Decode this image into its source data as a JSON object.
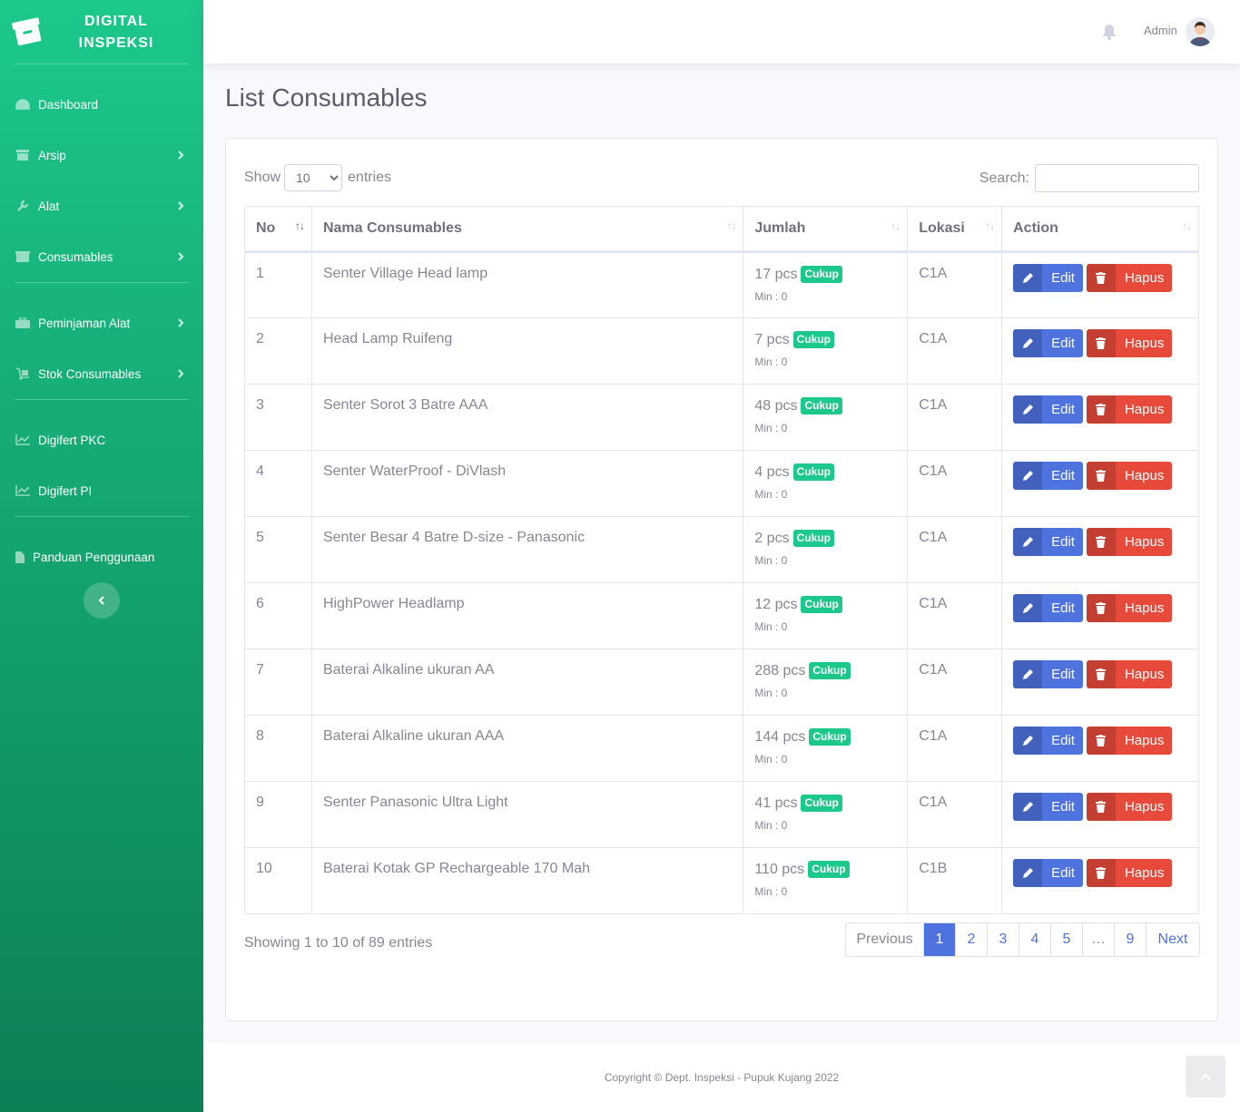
{
  "brand": {
    "line1": "DIGITAL",
    "line2": "INSPEKSI"
  },
  "sidebar": {
    "items": [
      {
        "label": "Dashboard",
        "icon": "tachometer-icon"
      },
      {
        "label": "Arsip",
        "icon": "archive-icon"
      },
      {
        "label": "Alat",
        "icon": "wrench-icon"
      },
      {
        "label": "Consumables",
        "icon": "box-icon"
      },
      {
        "label": "Peminjaman Alat",
        "icon": "toolbox-icon"
      },
      {
        "label": "Stok Consumables",
        "icon": "dolly-icon"
      },
      {
        "label": "Digifert PKC",
        "icon": "chart-line-icon"
      },
      {
        "label": "Digifert PI",
        "icon": "chart-line-icon"
      },
      {
        "label": "Panduan Penggunaan",
        "icon": "file-icon"
      }
    ]
  },
  "topbar": {
    "user_name": "Admin"
  },
  "page": {
    "title": "List Consumables"
  },
  "table_controls": {
    "show_label": "Show",
    "entries_label": "entries",
    "page_length": "10",
    "search_label": "Search:",
    "search_value": ""
  },
  "table": {
    "headers": [
      "No",
      "Nama Consumables",
      "Jumlah",
      "Lokasi",
      "Action"
    ],
    "rows": [
      {
        "no": "1",
        "name": "Senter Village Head lamp",
        "qty": "17 pcs",
        "status": "Cukup",
        "min": "Min : 0",
        "loc": "C1A"
      },
      {
        "no": "2",
        "name": "Head Lamp Ruifeng",
        "qty": "7 pcs",
        "status": "Cukup",
        "min": "Min : 0",
        "loc": "C1A"
      },
      {
        "no": "3",
        "name": "Senter Sorot 3 Batre AAA",
        "qty": "48 pcs",
        "status": "Cukup",
        "min": "Min : 0",
        "loc": "C1A"
      },
      {
        "no": "4",
        "name": "Senter WaterProof - DiVlash",
        "qty": "4 pcs",
        "status": "Cukup",
        "min": "Min : 0",
        "loc": "C1A"
      },
      {
        "no": "5",
        "name": "Senter Besar 4 Batre D-size - Panasonic",
        "qty": "2 pcs",
        "status": "Cukup",
        "min": "Min : 0",
        "loc": "C1A"
      },
      {
        "no": "6",
        "name": "HighPower Headlamp",
        "qty": "12 pcs",
        "status": "Cukup",
        "min": "Min : 0",
        "loc": "C1A"
      },
      {
        "no": "7",
        "name": "Baterai Alkaline ukuran AA",
        "qty": "288 pcs",
        "status": "Cukup",
        "min": "Min : 0",
        "loc": "C1A"
      },
      {
        "no": "8",
        "name": "Baterai Alkaline ukuran AAA",
        "qty": "144 pcs",
        "status": "Cukup",
        "min": "Min : 0",
        "loc": "C1A"
      },
      {
        "no": "9",
        "name": "Senter Panasonic Ultra Light",
        "qty": "41 pcs",
        "status": "Cukup",
        "min": "Min : 0",
        "loc": "C1A"
      },
      {
        "no": "10",
        "name": "Baterai Kotak GP Rechargeable 170 Mah",
        "qty": "110 pcs",
        "status": "Cukup",
        "min": "Min : 0",
        "loc": "C1B"
      }
    ],
    "edit_label": "Edit",
    "delete_label": "Hapus"
  },
  "pagination": {
    "info": "Showing 1 to 10 of 89 entries",
    "previous": "Previous",
    "next": "Next",
    "pages": [
      "1",
      "2",
      "3",
      "4",
      "5",
      "…",
      "9"
    ],
    "current": "1"
  },
  "footer": {
    "copyright": "Copyright © Dept. Inspeksi - Pupuk Kujang 2022"
  },
  "colors": {
    "sidebar": "#1cc88a",
    "primary": "#4e73df",
    "danger": "#e74a3b",
    "success": "#1cc88a"
  }
}
